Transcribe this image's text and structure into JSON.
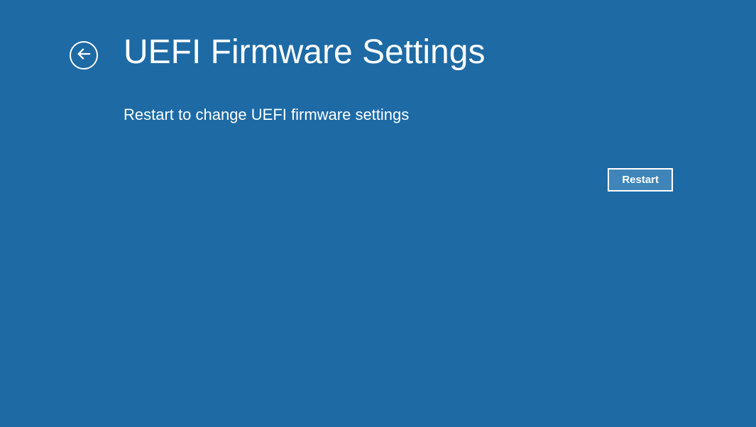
{
  "header": {
    "title": "UEFI Firmware Settings"
  },
  "main": {
    "description": "Restart to change UEFI firmware settings"
  },
  "actions": {
    "restart_label": "Restart"
  }
}
